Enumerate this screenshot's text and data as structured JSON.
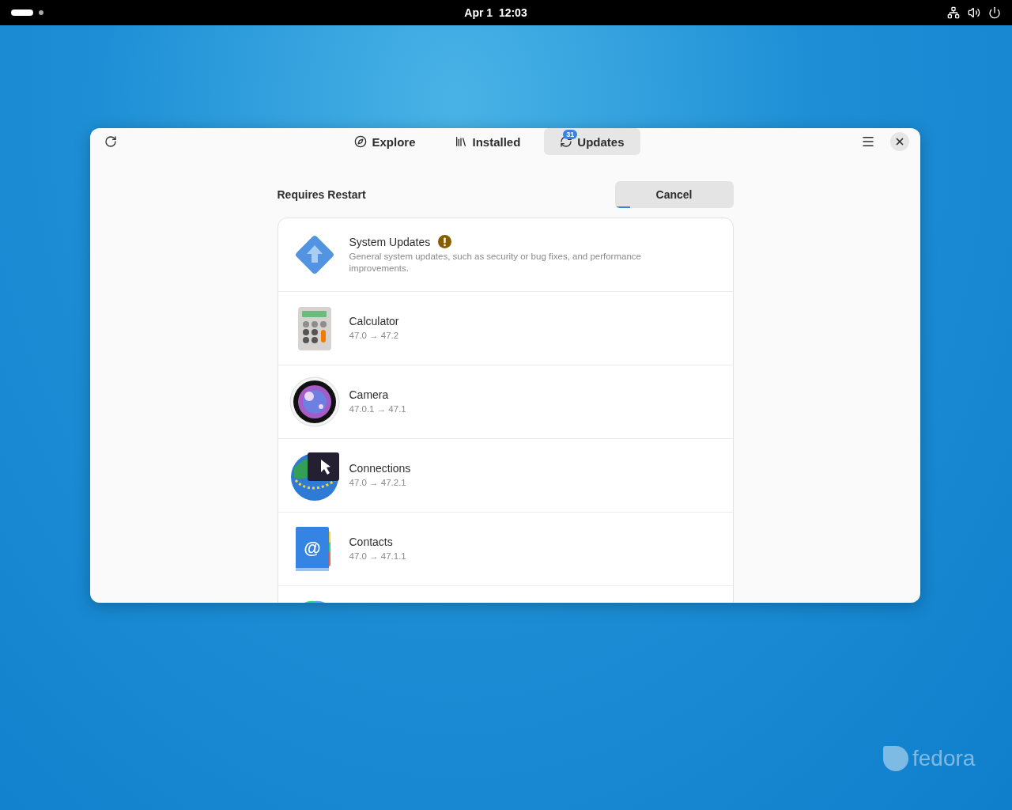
{
  "top_bar": {
    "clock": "Apr 1  12:03"
  },
  "window": {
    "tabs": [
      {
        "label": "Explore",
        "kind": "explore",
        "selected": false
      },
      {
        "label": "Installed",
        "kind": "installed",
        "selected": false
      },
      {
        "label": "Updates",
        "kind": "updates",
        "selected": true,
        "badge": "31"
      }
    ],
    "section": {
      "title": "Requires Restart",
      "button": "Cancel",
      "progress": {
        "level": 0.13
      }
    },
    "updates": [
      {
        "kind": "system",
        "name": "System Updates",
        "warning": true,
        "description": "General system updates, such as security or bug fixes, and performance improvements."
      },
      {
        "kind": "calculator",
        "name": "Calculator",
        "version": "47.0 → 47.2"
      },
      {
        "kind": "camera",
        "name": "Camera",
        "version": "47.0.1 → 47.1"
      },
      {
        "kind": "connections",
        "name": "Connections",
        "version": "47.0 → 47.2.1"
      },
      {
        "kind": "contacts",
        "name": "Contacts",
        "glyph": "@",
        "version": "47.0 → 47.1.1"
      },
      {
        "kind": "disk"
      }
    ]
  },
  "desktop": {
    "logo": "fedora"
  }
}
